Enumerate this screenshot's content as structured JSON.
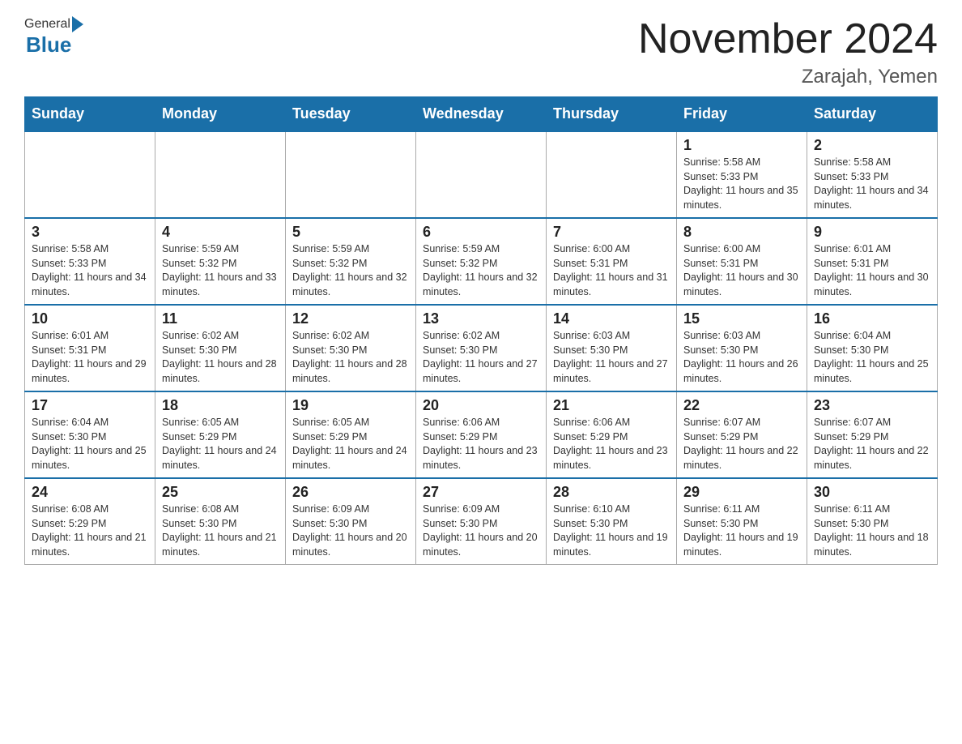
{
  "header": {
    "title": "November 2024",
    "location": "Zarajah, Yemen",
    "logo_general": "General",
    "logo_blue": "Blue"
  },
  "days_of_week": [
    "Sunday",
    "Monday",
    "Tuesday",
    "Wednesday",
    "Thursday",
    "Friday",
    "Saturday"
  ],
  "weeks": [
    [
      {
        "day": "",
        "info": ""
      },
      {
        "day": "",
        "info": ""
      },
      {
        "day": "",
        "info": ""
      },
      {
        "day": "",
        "info": ""
      },
      {
        "day": "",
        "info": ""
      },
      {
        "day": "1",
        "info": "Sunrise: 5:58 AM\nSunset: 5:33 PM\nDaylight: 11 hours and 35 minutes."
      },
      {
        "day": "2",
        "info": "Sunrise: 5:58 AM\nSunset: 5:33 PM\nDaylight: 11 hours and 34 minutes."
      }
    ],
    [
      {
        "day": "3",
        "info": "Sunrise: 5:58 AM\nSunset: 5:33 PM\nDaylight: 11 hours and 34 minutes."
      },
      {
        "day": "4",
        "info": "Sunrise: 5:59 AM\nSunset: 5:32 PM\nDaylight: 11 hours and 33 minutes."
      },
      {
        "day": "5",
        "info": "Sunrise: 5:59 AM\nSunset: 5:32 PM\nDaylight: 11 hours and 32 minutes."
      },
      {
        "day": "6",
        "info": "Sunrise: 5:59 AM\nSunset: 5:32 PM\nDaylight: 11 hours and 32 minutes."
      },
      {
        "day": "7",
        "info": "Sunrise: 6:00 AM\nSunset: 5:31 PM\nDaylight: 11 hours and 31 minutes."
      },
      {
        "day": "8",
        "info": "Sunrise: 6:00 AM\nSunset: 5:31 PM\nDaylight: 11 hours and 30 minutes."
      },
      {
        "day": "9",
        "info": "Sunrise: 6:01 AM\nSunset: 5:31 PM\nDaylight: 11 hours and 30 minutes."
      }
    ],
    [
      {
        "day": "10",
        "info": "Sunrise: 6:01 AM\nSunset: 5:31 PM\nDaylight: 11 hours and 29 minutes."
      },
      {
        "day": "11",
        "info": "Sunrise: 6:02 AM\nSunset: 5:30 PM\nDaylight: 11 hours and 28 minutes."
      },
      {
        "day": "12",
        "info": "Sunrise: 6:02 AM\nSunset: 5:30 PM\nDaylight: 11 hours and 28 minutes."
      },
      {
        "day": "13",
        "info": "Sunrise: 6:02 AM\nSunset: 5:30 PM\nDaylight: 11 hours and 27 minutes."
      },
      {
        "day": "14",
        "info": "Sunrise: 6:03 AM\nSunset: 5:30 PM\nDaylight: 11 hours and 27 minutes."
      },
      {
        "day": "15",
        "info": "Sunrise: 6:03 AM\nSunset: 5:30 PM\nDaylight: 11 hours and 26 minutes."
      },
      {
        "day": "16",
        "info": "Sunrise: 6:04 AM\nSunset: 5:30 PM\nDaylight: 11 hours and 25 minutes."
      }
    ],
    [
      {
        "day": "17",
        "info": "Sunrise: 6:04 AM\nSunset: 5:30 PM\nDaylight: 11 hours and 25 minutes."
      },
      {
        "day": "18",
        "info": "Sunrise: 6:05 AM\nSunset: 5:29 PM\nDaylight: 11 hours and 24 minutes."
      },
      {
        "day": "19",
        "info": "Sunrise: 6:05 AM\nSunset: 5:29 PM\nDaylight: 11 hours and 24 minutes."
      },
      {
        "day": "20",
        "info": "Sunrise: 6:06 AM\nSunset: 5:29 PM\nDaylight: 11 hours and 23 minutes."
      },
      {
        "day": "21",
        "info": "Sunrise: 6:06 AM\nSunset: 5:29 PM\nDaylight: 11 hours and 23 minutes."
      },
      {
        "day": "22",
        "info": "Sunrise: 6:07 AM\nSunset: 5:29 PM\nDaylight: 11 hours and 22 minutes."
      },
      {
        "day": "23",
        "info": "Sunrise: 6:07 AM\nSunset: 5:29 PM\nDaylight: 11 hours and 22 minutes."
      }
    ],
    [
      {
        "day": "24",
        "info": "Sunrise: 6:08 AM\nSunset: 5:29 PM\nDaylight: 11 hours and 21 minutes."
      },
      {
        "day": "25",
        "info": "Sunrise: 6:08 AM\nSunset: 5:30 PM\nDaylight: 11 hours and 21 minutes."
      },
      {
        "day": "26",
        "info": "Sunrise: 6:09 AM\nSunset: 5:30 PM\nDaylight: 11 hours and 20 minutes."
      },
      {
        "day": "27",
        "info": "Sunrise: 6:09 AM\nSunset: 5:30 PM\nDaylight: 11 hours and 20 minutes."
      },
      {
        "day": "28",
        "info": "Sunrise: 6:10 AM\nSunset: 5:30 PM\nDaylight: 11 hours and 19 minutes."
      },
      {
        "day": "29",
        "info": "Sunrise: 6:11 AM\nSunset: 5:30 PM\nDaylight: 11 hours and 19 minutes."
      },
      {
        "day": "30",
        "info": "Sunrise: 6:11 AM\nSunset: 5:30 PM\nDaylight: 11 hours and 18 minutes."
      }
    ]
  ]
}
